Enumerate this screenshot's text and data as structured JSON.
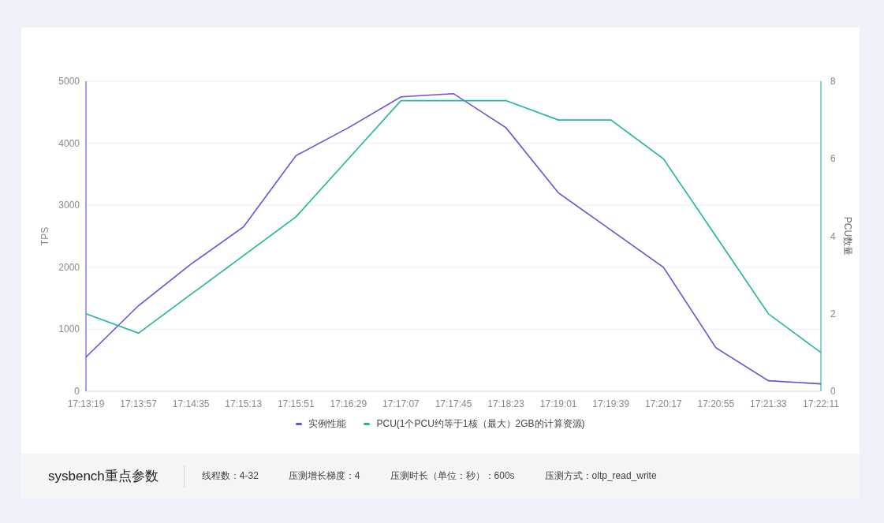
{
  "chart": {
    "chart_data": {
      "type": "line",
      "grid": true,
      "ylabel": "TPS",
      "y2label": "PCU数量",
      "ylim": [
        0,
        5000
      ],
      "y2lim": [
        0,
        8
      ],
      "categories": [
        "17:13:19",
        "17:13:57",
        "17:14:35",
        "17:15:13",
        "17:15:51",
        "17:16:29",
        "17:17:07",
        "17:17:45",
        "17:18:23",
        "17:19:01",
        "17:19:39",
        "17:20:17",
        "17:20:55",
        "17:21:33",
        "17:22:11"
      ],
      "yticks": [
        0,
        1000,
        2000,
        3000,
        4000,
        5000
      ],
      "y2ticks": [
        0,
        2,
        4,
        6,
        8
      ],
      "series": [
        {
          "name": "实例性能",
          "color": "#6b4fd8",
          "values": [
            550,
            1380,
            2050,
            2650,
            3800,
            4250,
            4750,
            4800,
            4250,
            3200,
            2600,
            2000,
            700,
            170,
            120
          ]
        },
        {
          "name": "PCU(1个PCU约等于1核（最大）2GB的计算资源)",
          "color": "#1fb5a0",
          "axis": "y2",
          "values": [
            2,
            1.5,
            2.5,
            3.5,
            4.5,
            6,
            7.5,
            7.5,
            7.5,
            7,
            7,
            6,
            4,
            2,
            1
          ]
        }
      ]
    }
  },
  "footer": {
    "title": "sysbench重点参数",
    "params": [
      "线程数：4-32",
      "压测增长梯度：4",
      "压测时长（单位：秒）：600s",
      "压测方式：oltp_read_write"
    ]
  }
}
